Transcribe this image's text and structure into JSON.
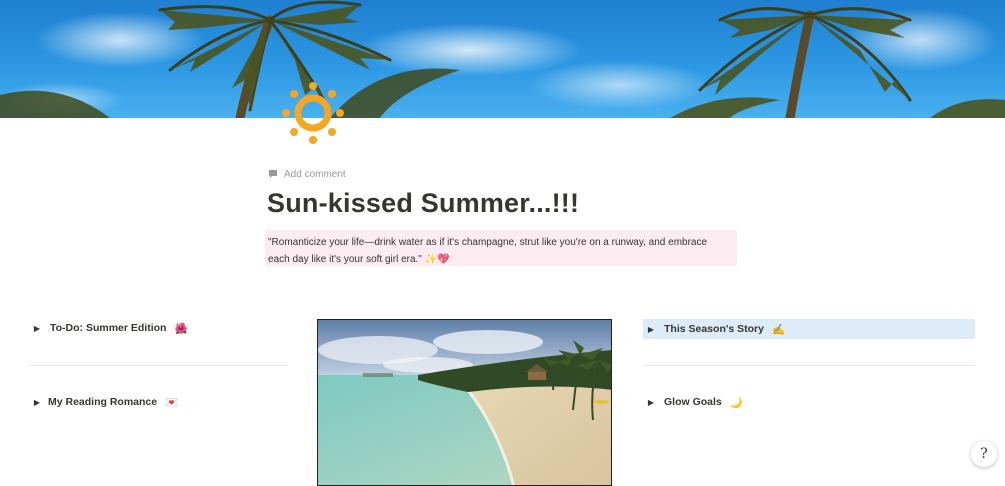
{
  "cover": {
    "alt": "palm trees against blue sky"
  },
  "header": {
    "add_comment_label": "Add comment",
    "title": "Sun-kissed Summer...!!!",
    "quote_line1": "\"Romanticize your life—drink water as if it's champagne, strut like you're on a runway, and embrace",
    "quote_line2": "each day like it's your soft girl era.\"",
    "quote_emoji": "✨💖"
  },
  "left_column": {
    "items": [
      {
        "label": "To-Do: Summer Edition",
        "emoji": "🌺"
      },
      {
        "label": "My Reading Romance",
        "emoji": "💌"
      }
    ]
  },
  "right_column": {
    "items": [
      {
        "label": "This Season's Story",
        "emoji": "✍️"
      },
      {
        "label": "Glow Goals",
        "emoji": "🌙"
      }
    ]
  },
  "center_image": {
    "alt": "tropical beach with turquoise water"
  },
  "help": {
    "label": "?"
  },
  "colors": {
    "sun": "#f5a623",
    "quote_bg": "#fbecf1",
    "story_bg": "#ddebf8",
    "text": "#37352f"
  },
  "icons": [
    "sun-icon",
    "comment-icon",
    "toggle-triangle-icon",
    "help-icon"
  ]
}
